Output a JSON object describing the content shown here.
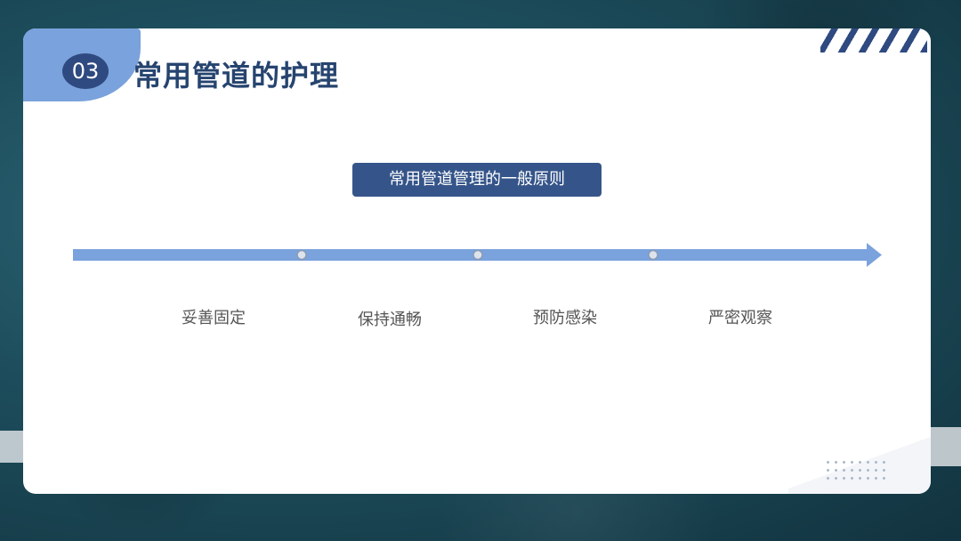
{
  "section": {
    "number": "03",
    "title": "常用管道的护理"
  },
  "principles": {
    "heading": "常用管道管理的一般原则",
    "items": [
      {
        "label": "妥善固定"
      },
      {
        "label": "保持通畅"
      },
      {
        "label": "预防感染"
      },
      {
        "label": "严密观察"
      }
    ]
  },
  "colors": {
    "accent_dark": "#2e4a80",
    "accent_light": "#7aa2dc",
    "title_text": "#26446f",
    "background": "#1d4d5c"
  }
}
